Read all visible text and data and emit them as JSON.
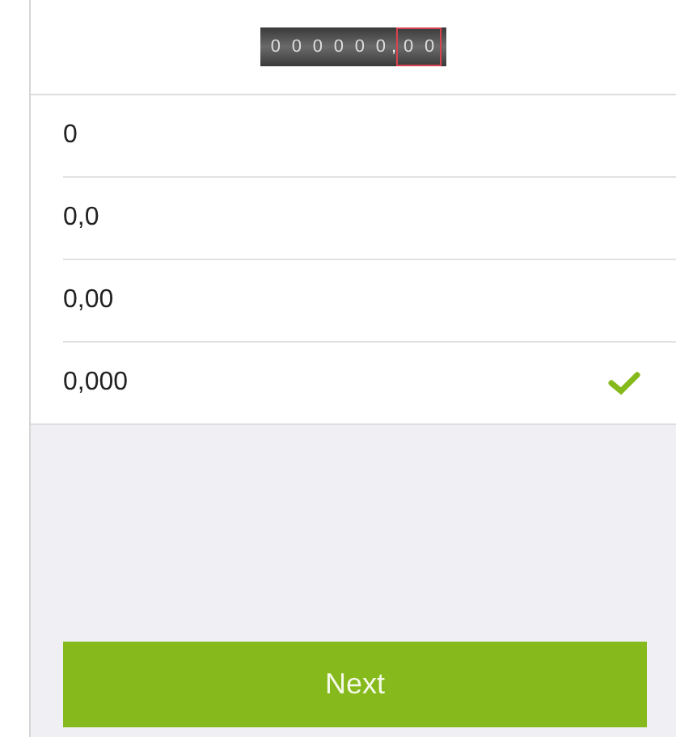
{
  "odometer": {
    "integer_digits": [
      "0",
      "0",
      "0",
      "0",
      "0",
      "0"
    ],
    "separator": ",",
    "decimal_digits": [
      "0",
      "0"
    ]
  },
  "options": [
    {
      "label": "0",
      "selected": false
    },
    {
      "label": "0,0",
      "selected": false
    },
    {
      "label": "0,00",
      "selected": false
    },
    {
      "label": "0,000",
      "selected": true
    }
  ],
  "button": "Next"
}
